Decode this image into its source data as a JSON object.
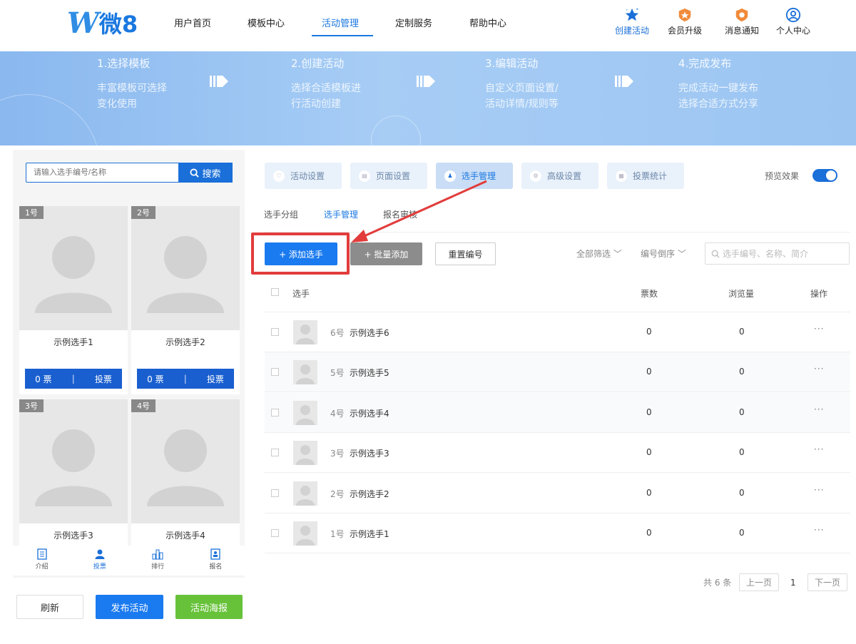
{
  "header": {
    "logo_mark": "W",
    "logo_text": "微8",
    "nav": [
      "用户首页",
      "模板中心",
      "活动管理",
      "定制服务",
      "帮助中心"
    ],
    "actions": [
      {
        "label": "创建活动",
        "icon": "star-icon"
      },
      {
        "label": "会员升级",
        "icon": "vip-badge-icon"
      },
      {
        "label": "消息通知",
        "icon": "bell-badge-icon"
      },
      {
        "label": "个人中心",
        "icon": "user-circle-icon"
      }
    ]
  },
  "banner": {
    "steps": [
      {
        "title": "1.选择模板",
        "line1": "丰富模板可选择",
        "line2": "变化使用"
      },
      {
        "title": "2.创建活动",
        "line1": "选择合适模板进",
        "line2": "行活动创建"
      },
      {
        "title": "3.编辑活动",
        "line1": "自定义页面设置/",
        "line2": "活动详情/规则等"
      },
      {
        "title": "4.完成发布",
        "line1": "完成活动一键发布",
        "line2": "选择合适方式分享"
      }
    ]
  },
  "preview": {
    "search_placeholder": "请输入选手编号/名称",
    "search_btn": "搜索",
    "cards": [
      {
        "badge": "1号",
        "name": "示例选手1",
        "votes": "0 票",
        "vote_btn": "投票"
      },
      {
        "badge": "2号",
        "name": "示例选手2",
        "votes": "0 票",
        "vote_btn": "投票"
      },
      {
        "badge": "3号",
        "name": "示例选手3"
      },
      {
        "badge": "4号",
        "name": "示例选手4"
      }
    ],
    "tabbar": [
      "介绍",
      "投票",
      "排行",
      "报名"
    ],
    "buttons": [
      "刷新",
      "发布活动",
      "活动海报"
    ]
  },
  "settings": {
    "tabs": [
      "活动设置",
      "页面设置",
      "选手管理",
      "高级设置",
      "投票统计"
    ],
    "preview_label": "预览效果",
    "subtabs": [
      "选手分组",
      "选手管理",
      "报名审核"
    ],
    "add_btn": "+ 添加选手",
    "batch_btn": "+ 批量添加",
    "reset_btn": "重置编号",
    "filter": "全部筛选",
    "sort": "编号倒序",
    "search_placeholder": "选手编号、名称、简介",
    "columns": [
      "选手",
      "票数",
      "浏览量",
      "操作"
    ],
    "rows": [
      {
        "num": "6号",
        "name": "示例选手6",
        "votes": "0",
        "views": "0",
        "op": "···"
      },
      {
        "num": "5号",
        "name": "示例选手5",
        "votes": "0",
        "views": "0",
        "op": "···"
      },
      {
        "num": "4号",
        "name": "示例选手4",
        "votes": "0",
        "views": "0",
        "op": "···"
      },
      {
        "num": "3号",
        "name": "示例选手3",
        "votes": "0",
        "views": "0",
        "op": "···"
      },
      {
        "num": "2号",
        "name": "示例选手2",
        "votes": "0",
        "views": "0",
        "op": "···"
      },
      {
        "num": "1号",
        "name": "示例选手1",
        "votes": "0",
        "views": "0",
        "op": "···"
      }
    ],
    "pager": {
      "total": "共 6 条",
      "prev": "上一页",
      "page": "1",
      "next": "下一页"
    }
  },
  "colors": {
    "primary": "#1a6fd8",
    "green": "#67c23a",
    "highlight": "#e23c3c"
  }
}
